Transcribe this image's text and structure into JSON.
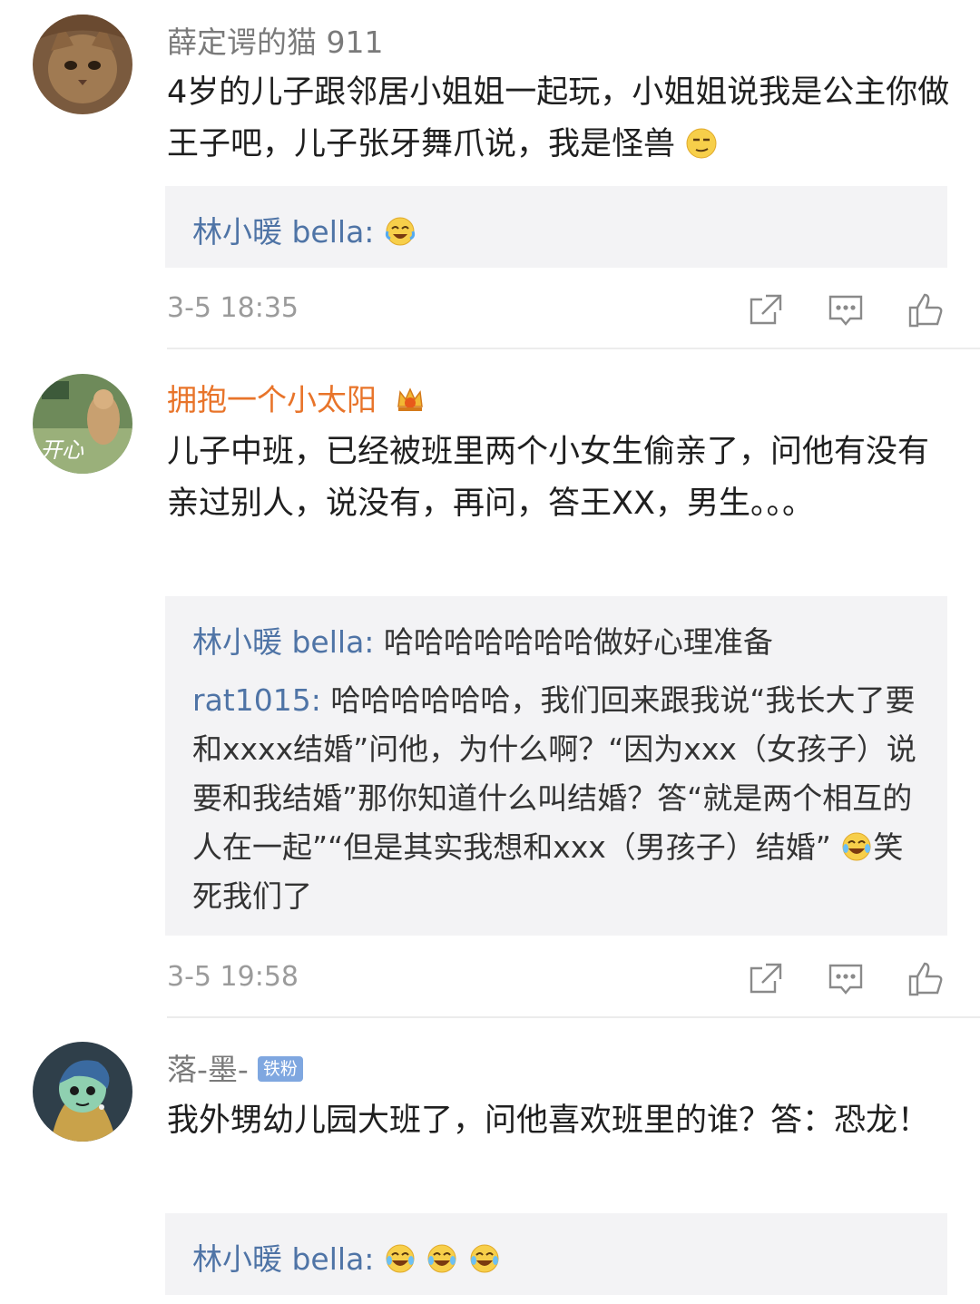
{
  "comments": [
    {
      "username": "薛定谔的猫 911",
      "text": "4岁的儿子跟邻居小姐姐一起玩，小姐姐说我是公主你做王子吧，儿子张牙舞爪说，我是怪兽",
      "text_emoji": "smirk-emoji",
      "replies": [
        {
          "name": "林小暖 bella:",
          "text": "",
          "emojis": [
            "laugh-cry-emoji"
          ]
        }
      ],
      "time": "3-5 18:35"
    },
    {
      "username": "拥抱一个小太阳",
      "avatar_text": "开心",
      "text": "儿子中班，已经被班里两个小女生偷亲了，问他有没有亲过别人，说没有，再问，答王XX，男生。。。",
      "replies": [
        {
          "name": "林小暖 bella:",
          "text": "哈哈哈哈哈哈哈做好心理准备"
        },
        {
          "name": "rat1015:",
          "text": "哈哈哈哈哈哈，我们回来跟我说“我长大了要和xxxx结婚”问他，为什么啊？“因为xxx（女孩子）说要和我结婚”那你知道什么叫结婚？答“就是两个相互的人在一起”“但是其实我想和xxx（男孩子）结婚”",
          "tail": "笑死我们了"
        }
      ],
      "time": "3-5 19:58"
    },
    {
      "username": "落-墨-",
      "badge": "铁粉",
      "text": "我外甥幼儿园大班了，问他喜欢班里的谁？答：恐龙！",
      "replies": [
        {
          "name": "林小暖 bella:",
          "text": "",
          "emojis": [
            "laugh-emoji",
            "laugh-emoji",
            "laugh-emoji"
          ]
        }
      ]
    }
  ],
  "icons": {
    "share": "share-icon",
    "comment": "comment-icon",
    "like": "like-icon"
  },
  "colors": {
    "username_orange": "#e8742a",
    "reply_name": "#4f74a6",
    "reply_bg": "#f3f3f5"
  }
}
